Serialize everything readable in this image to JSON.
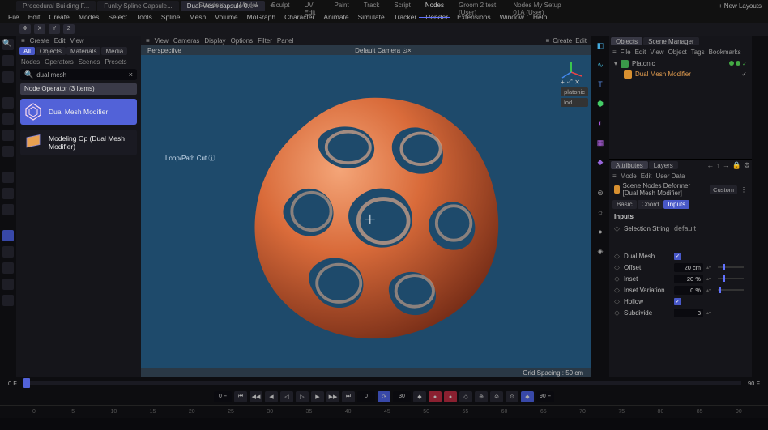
{
  "tabs": {
    "docs": [
      "Procedural Building F...",
      "Funky Spline Capsule...",
      "Dual Mesh capsule 0..."
    ],
    "active": 2,
    "layouts": [
      "Standard",
      "Model",
      "Sculpt",
      "UV Edit",
      "Paint",
      "Track",
      "Script",
      "Nodes",
      "Groom 2 test (User)",
      "Nodes My Setup 01A (User)"
    ],
    "layoutActive": 7,
    "newLayout": "+ New Layouts"
  },
  "menu": [
    "File",
    "Edit",
    "Create",
    "Modes",
    "Select",
    "Tools",
    "Spline",
    "Mesh",
    "Volume",
    "MoGraph",
    "Character",
    "Animate",
    "Simulate",
    "Tracker",
    "Render",
    "Extensions",
    "Window",
    "Help"
  ],
  "axis": [
    "X",
    "Y",
    "Z"
  ],
  "leftPanel": {
    "menu": [
      "Create",
      "Edit",
      "View"
    ],
    "topTabs": [
      "All",
      "Objects",
      "Materials",
      "Media"
    ],
    "row2": [
      "Nodes",
      "Operators",
      "Scenes",
      "Presets"
    ],
    "search": "dual mesh",
    "header": "Node Operator (3 Items)",
    "results": [
      {
        "label": "Dual Mesh Modifier",
        "sel": true
      },
      {
        "label": "Modeling Op (Dual Mesh Modifier)",
        "sel": false
      }
    ]
  },
  "viewport": {
    "menu": [
      "View",
      "Cameras",
      "Display",
      "Options",
      "Filter",
      "Panel"
    ],
    "menuR": [
      "Create",
      "Edit"
    ],
    "label": "Perspective",
    "camera": "Default Camera",
    "overlay": "Loop/Path Cut",
    "footer": "Grid Spacing : 50 cm",
    "sideTags": [
      "platonic",
      "lod"
    ]
  },
  "rightPanel": {
    "topTabs": [
      "Objects",
      "Scene Manager"
    ],
    "menu": [
      "File",
      "Edit",
      "View",
      "Object",
      "Tags",
      "Bookmarks"
    ],
    "tree": [
      {
        "name": "Platonic",
        "color": "#3a9a4a"
      },
      {
        "name": "Dual Mesh Modifier",
        "color": "#d89030",
        "indent": true
      }
    ],
    "attrTabs": [
      "Attributes",
      "Layers"
    ],
    "attrMenu": [
      "Mode",
      "Edit",
      "User Data"
    ],
    "attrTitle": "Scene Nodes Deformer [Dual Mesh Modifier]",
    "attrPreset": "Custom",
    "subTabs": [
      "Basic",
      "Coord",
      "Inputs"
    ],
    "groupLabel": "Inputs",
    "selString": {
      "lbl": "Selection String",
      "val": "default"
    },
    "params": [
      {
        "lbl": "Dual Mesh",
        "type": "check",
        "checked": true
      },
      {
        "lbl": "Offset",
        "type": "slider",
        "val": "20 cm",
        "pct": 18
      },
      {
        "lbl": "Inset",
        "type": "slider",
        "val": "20 %",
        "pct": 18
      },
      {
        "lbl": "Inset Variation",
        "type": "slider",
        "val": "0 %",
        "pct": 2
      },
      {
        "lbl": "Hollow",
        "type": "check",
        "checked": true
      },
      {
        "lbl": "Subdivide",
        "type": "num",
        "val": "3"
      }
    ]
  },
  "transport": {
    "frameStart": "0 F",
    "frameEnd": "90 F",
    "cur": "0",
    "fps": "30"
  },
  "frameTicks": [
    0,
    5,
    10,
    15,
    20,
    25,
    30,
    35,
    40,
    45,
    50,
    55,
    60,
    65,
    70,
    75,
    80,
    85,
    90
  ]
}
